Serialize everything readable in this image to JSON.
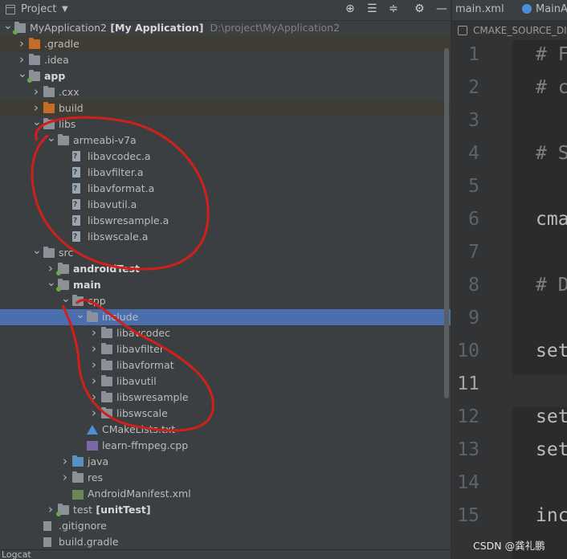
{
  "project_panel": {
    "title": "Project",
    "toolbar_icons": [
      "locate-icon",
      "collapse-all-icon",
      "expand-all-icon",
      "gear-icon",
      "minimize-icon"
    ],
    "tree": [
      {
        "label": "MyApplication2",
        "bold_suffix": "[My Application]",
        "path": "D:\\project\\MyApplication2",
        "level": 0,
        "arrow": "down",
        "icon": "module-folder"
      },
      {
        "label": ".gradle",
        "level": 1,
        "arrow": "right",
        "icon": "folder-orange",
        "highlight": true
      },
      {
        "label": ".idea",
        "level": 1,
        "arrow": "right",
        "icon": "folder"
      },
      {
        "label": "app",
        "level": 1,
        "arrow": "down",
        "icon": "module-folder",
        "bold": true
      },
      {
        "label": ".cxx",
        "level": 2,
        "arrow": "right",
        "icon": "folder"
      },
      {
        "label": "build",
        "level": 2,
        "arrow": "right",
        "icon": "folder-orange",
        "highlight": true
      },
      {
        "label": "libs",
        "level": 2,
        "arrow": "down",
        "icon": "folder"
      },
      {
        "label": "armeabi-v7a",
        "level": 3,
        "arrow": "down",
        "icon": "folder"
      },
      {
        "label": "libavcodec.a",
        "level": 4,
        "icon": "unknown-file"
      },
      {
        "label": "libavfilter.a",
        "level": 4,
        "icon": "unknown-file"
      },
      {
        "label": "libavformat.a",
        "level": 4,
        "icon": "unknown-file"
      },
      {
        "label": "libavutil.a",
        "level": 4,
        "icon": "unknown-file"
      },
      {
        "label": "libswresample.a",
        "level": 4,
        "icon": "unknown-file"
      },
      {
        "label": "libswscale.a",
        "level": 4,
        "icon": "unknown-file"
      },
      {
        "label": "src",
        "level": 2,
        "arrow": "down",
        "icon": "folder"
      },
      {
        "label": "androidTest",
        "level": 3,
        "arrow": "right",
        "icon": "folder-dot",
        "bold": true
      },
      {
        "label": "main",
        "level": 3,
        "arrow": "down",
        "icon": "folder-dot",
        "bold": true
      },
      {
        "label": "cpp",
        "level": 4,
        "arrow": "down",
        "icon": "folder"
      },
      {
        "label": "include",
        "level": 5,
        "arrow": "down",
        "icon": "folder",
        "selected": true
      },
      {
        "label": "libavcodec",
        "level": 6,
        "arrow": "right",
        "icon": "folder"
      },
      {
        "label": "libavfilter",
        "level": 6,
        "arrow": "right",
        "icon": "folder"
      },
      {
        "label": "libavformat",
        "level": 6,
        "arrow": "right",
        "icon": "folder"
      },
      {
        "label": "libavutil",
        "level": 6,
        "arrow": "right",
        "icon": "folder"
      },
      {
        "label": "libswresample",
        "level": 6,
        "arrow": "right",
        "icon": "folder"
      },
      {
        "label": "libswscale",
        "level": 6,
        "arrow": "right",
        "icon": "folder"
      },
      {
        "label": "CMakeLists.txt",
        "level": 5,
        "icon": "cmake-file"
      },
      {
        "label": "learn-ffmpeg.cpp",
        "level": 5,
        "icon": "cpp-file"
      },
      {
        "label": "java",
        "level": 4,
        "arrow": "right",
        "icon": "folder-blue"
      },
      {
        "label": "res",
        "level": 4,
        "arrow": "right",
        "icon": "folder"
      },
      {
        "label": "AndroidManifest.xml",
        "level": 4,
        "icon": "manifest-file"
      },
      {
        "label": "test",
        "bold_suffix": "[unitTest]",
        "level": 3,
        "arrow": "right",
        "icon": "folder-dot"
      },
      {
        "label": ".gitignore",
        "level": 2,
        "icon": "git-file"
      },
      {
        "label": "build.gradle",
        "level": 2,
        "icon": "gradle-file"
      }
    ]
  },
  "editor": {
    "tabs": [
      {
        "label": "main.xml"
      },
      {
        "label": "MainA"
      }
    ],
    "breadcrumb": "CMAKE_SOURCE_DI",
    "current_line": "11",
    "lines": [
      {
        "n": "1",
        "text": "# F",
        "kind": "comment"
      },
      {
        "n": "2",
        "text": "# c",
        "kind": "comment"
      },
      {
        "n": "3",
        "text": "",
        "kind": "blank"
      },
      {
        "n": "4",
        "text": "# S",
        "kind": "comment"
      },
      {
        "n": "5",
        "text": "",
        "kind": "blank"
      },
      {
        "n": "6",
        "text": "cma",
        "kind": "code"
      },
      {
        "n": "7",
        "text": "",
        "kind": "blank"
      },
      {
        "n": "8",
        "text": "# D",
        "kind": "comment"
      },
      {
        "n": "9",
        "text": "",
        "kind": "blank"
      },
      {
        "n": "10",
        "text": "set",
        "kind": "code"
      },
      {
        "n": "11",
        "text": "",
        "kind": "blank"
      },
      {
        "n": "12",
        "text": "set",
        "kind": "code"
      },
      {
        "n": "13",
        "text": "set",
        "kind": "code"
      },
      {
        "n": "14",
        "text": "",
        "kind": "blank"
      },
      {
        "n": "15",
        "text": "inc",
        "kind": "code"
      }
    ]
  },
  "status_bar": {
    "logcat_label": "Logcat"
  },
  "watermark": "CSDN @龚礼鹏",
  "colors": {
    "selection": "#4b6eaf",
    "annotation": "#d0201a",
    "panel_bg": "#3c3f41",
    "editor_bg": "#2b2b2b"
  }
}
